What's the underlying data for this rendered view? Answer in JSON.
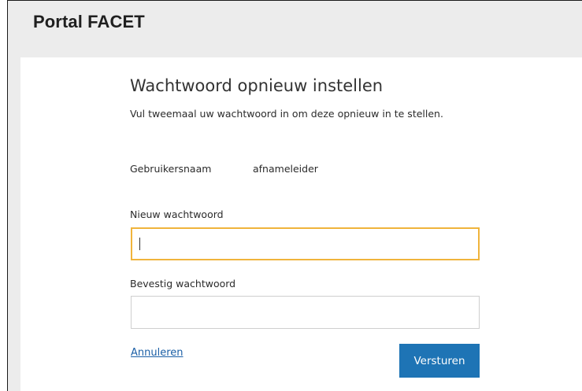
{
  "header": {
    "title": "Portal FACET"
  },
  "form": {
    "heading": "Wachtwoord opnieuw instellen",
    "subtitle": "Vul tweemaal uw wachtwoord in om deze opnieuw in te stellen.",
    "username_label": "Gebruikersnaam",
    "username_value": "afnameleider",
    "new_password_label": "Nieuw wachtwoord",
    "new_password_value": "",
    "confirm_password_label": "Bevestig wachtwoord",
    "confirm_password_value": "",
    "cancel_label": "Annuleren",
    "submit_label": "Versturen"
  },
  "colors": {
    "accent": "#1e74b5",
    "focus_border": "#f0b43c",
    "link": "#1b5fa6",
    "background": "#ececec"
  }
}
